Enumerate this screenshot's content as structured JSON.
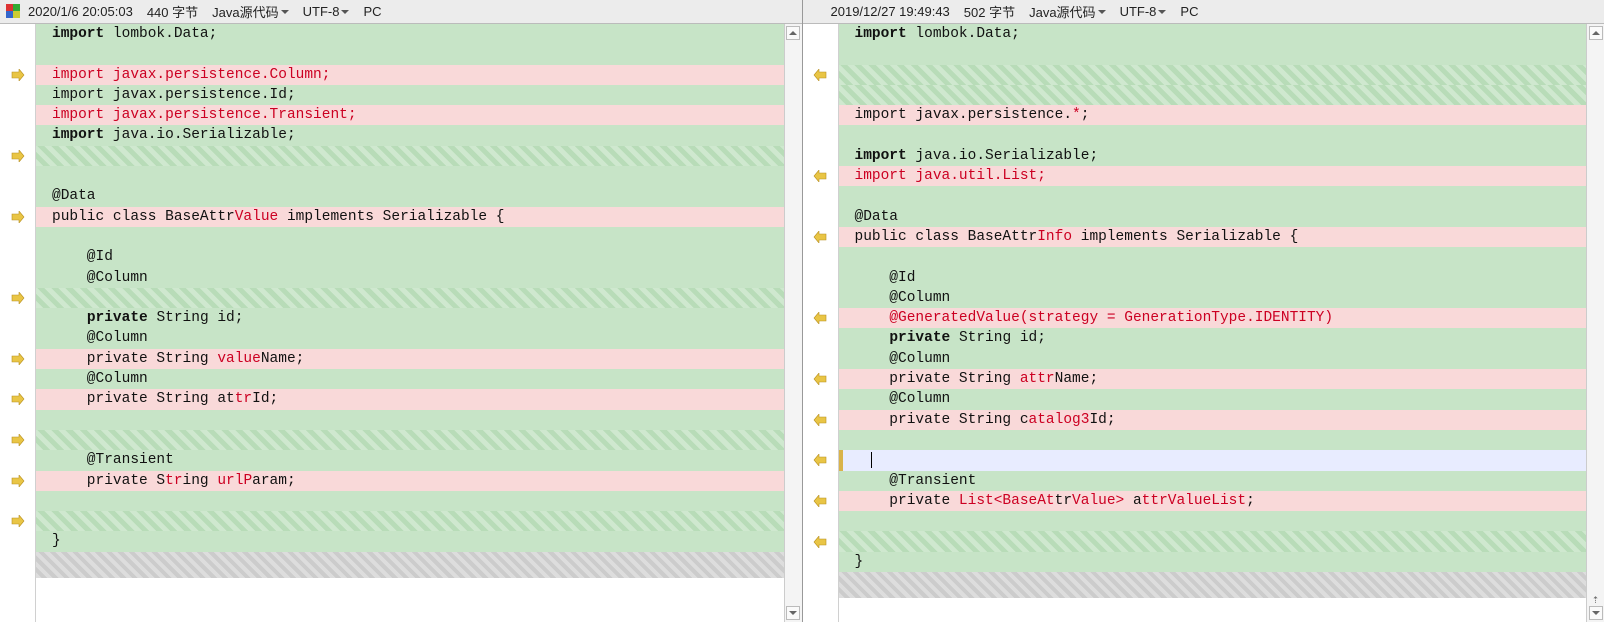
{
  "left": {
    "header": {
      "timestamp": "2020/1/6 20:05:03",
      "size": "440 字节",
      "type": "Java源代码",
      "encoding": "UTF-8",
      "lineend": "PC"
    },
    "lines": [
      {
        "bg": "same",
        "arrow": "",
        "spans": [
          {
            "t": "import ",
            "cls": "kw"
          },
          {
            "t": "lombok.Data;"
          }
        ]
      },
      {
        "bg": "same",
        "arrow": "",
        "spans": []
      },
      {
        "bg": "diff",
        "arrow": "r",
        "spans": [
          {
            "t": "import ",
            "cls": "rd"
          },
          {
            "t": "javax.persistence.Column;",
            "cls": "rd"
          }
        ]
      },
      {
        "bg": "same",
        "arrow": "",
        "spans": [
          {
            "t": "import javax.persistence.Id;"
          }
        ]
      },
      {
        "bg": "diff",
        "arrow": "",
        "spans": [
          {
            "t": "import ",
            "cls": "rd"
          },
          {
            "t": "javax.persistence.Transient;",
            "cls": "rd"
          }
        ]
      },
      {
        "bg": "same",
        "arrow": "",
        "spans": [
          {
            "t": "import ",
            "cls": "kw"
          },
          {
            "t": "java.io.Serializable;"
          }
        ]
      },
      {
        "bg": "hatch",
        "arrow": "r",
        "spans": []
      },
      {
        "bg": "same",
        "arrow": "",
        "spans": []
      },
      {
        "bg": "same",
        "arrow": "",
        "spans": [
          {
            "t": "@Data"
          }
        ]
      },
      {
        "bg": "diff",
        "arrow": "r",
        "spans": [
          {
            "t": "public class BaseAttr"
          },
          {
            "t": "Value",
            "cls": "rd"
          },
          {
            "t": " implements Serializable {"
          }
        ]
      },
      {
        "bg": "same",
        "arrow": "",
        "spans": []
      },
      {
        "bg": "same",
        "arrow": "",
        "spans": [
          {
            "t": "    @Id"
          }
        ]
      },
      {
        "bg": "same",
        "arrow": "",
        "spans": [
          {
            "t": "    @Column"
          }
        ]
      },
      {
        "bg": "hatch",
        "arrow": "r",
        "spans": []
      },
      {
        "bg": "same",
        "arrow": "",
        "spans": [
          {
            "t": "    ",
            "cls": ""
          },
          {
            "t": "private ",
            "cls": "kw"
          },
          {
            "t": "String id;"
          }
        ]
      },
      {
        "bg": "same",
        "arrow": "",
        "spans": [
          {
            "t": "    @Column"
          }
        ]
      },
      {
        "bg": "diff",
        "arrow": "r",
        "spans": [
          {
            "t": "    private String "
          },
          {
            "t": "value",
            "cls": "rd"
          },
          {
            "t": "Name;"
          }
        ]
      },
      {
        "bg": "same",
        "arrow": "",
        "spans": [
          {
            "t": "    @Column"
          }
        ]
      },
      {
        "bg": "diff",
        "arrow": "r",
        "spans": [
          {
            "t": "    private String at"
          },
          {
            "t": "tr",
            "cls": "rd"
          },
          {
            "t": "Id;"
          }
        ]
      },
      {
        "bg": "same",
        "arrow": "",
        "spans": []
      },
      {
        "bg": "hatch",
        "arrow": "r",
        "spans": []
      },
      {
        "bg": "same",
        "arrow": "",
        "spans": [
          {
            "t": "    @Transient"
          }
        ]
      },
      {
        "bg": "diff",
        "arrow": "r",
        "spans": [
          {
            "t": "    private S"
          },
          {
            "t": "tr",
            "cls": "rd"
          },
          {
            "t": "ing "
          },
          {
            "t": "urlP",
            "cls": "rd"
          },
          {
            "t": "aram;"
          }
        ]
      },
      {
        "bg": "same",
        "arrow": "",
        "spans": []
      },
      {
        "bg": "hatch",
        "arrow": "r",
        "spans": []
      },
      {
        "bg": "same",
        "arrow": "",
        "spans": [
          {
            "t": "}"
          }
        ]
      }
    ]
  },
  "right": {
    "header": {
      "timestamp": "2019/12/27 19:49:43",
      "size": "502 字节",
      "type": "Java源代码",
      "encoding": "UTF-8",
      "lineend": "PC"
    },
    "lines": [
      {
        "bg": "same",
        "arrow": "",
        "spans": [
          {
            "t": "import ",
            "cls": "kw"
          },
          {
            "t": "lombok.Data;"
          }
        ]
      },
      {
        "bg": "same",
        "arrow": "",
        "spans": []
      },
      {
        "bg": "hatch",
        "arrow": "l",
        "spans": []
      },
      {
        "bg": "hatch",
        "arrow": "",
        "spans": []
      },
      {
        "bg": "diff",
        "arrow": "",
        "spans": [
          {
            "t": "import javax.persistence."
          },
          {
            "t": "*",
            "cls": "rd"
          },
          {
            "t": ";"
          }
        ]
      },
      {
        "bg": "same",
        "arrow": "",
        "spans": []
      },
      {
        "bg": "same",
        "arrow": "",
        "spans": [
          {
            "t": "import ",
            "cls": "kw"
          },
          {
            "t": "java.io.Serializable;"
          }
        ]
      },
      {
        "bg": "diff",
        "arrow": "l",
        "spans": [
          {
            "t": "import ",
            "cls": "rd"
          },
          {
            "t": "java.util.List;",
            "cls": "rd"
          }
        ]
      },
      {
        "bg": "same",
        "arrow": "",
        "spans": []
      },
      {
        "bg": "same",
        "arrow": "",
        "spans": [
          {
            "t": "@Data"
          }
        ]
      },
      {
        "bg": "diff",
        "arrow": "l",
        "spans": [
          {
            "t": "public class BaseAttr"
          },
          {
            "t": "Info",
            "cls": "rd"
          },
          {
            "t": " implements Serializable {"
          }
        ]
      },
      {
        "bg": "same",
        "arrow": "",
        "spans": []
      },
      {
        "bg": "same",
        "arrow": "",
        "spans": [
          {
            "t": "    @Id"
          }
        ]
      },
      {
        "bg": "same",
        "arrow": "",
        "spans": [
          {
            "t": "    @Column"
          }
        ]
      },
      {
        "bg": "diff",
        "arrow": "l",
        "spans": [
          {
            "t": "    "
          },
          {
            "t": "@GeneratedValue(strategy = GenerationType.IDENTITY)",
            "cls": "rd"
          }
        ]
      },
      {
        "bg": "same",
        "arrow": "",
        "spans": [
          {
            "t": "    ",
            "cls": ""
          },
          {
            "t": "private ",
            "cls": "kw"
          },
          {
            "t": "String id;"
          }
        ]
      },
      {
        "bg": "same",
        "arrow": "",
        "spans": [
          {
            "t": "    @Column"
          }
        ]
      },
      {
        "bg": "diff",
        "arrow": "l",
        "spans": [
          {
            "t": "    private String "
          },
          {
            "t": "attr",
            "cls": "rd"
          },
          {
            "t": "Name;"
          }
        ]
      },
      {
        "bg": "same",
        "arrow": "",
        "spans": [
          {
            "t": "    @Column"
          }
        ]
      },
      {
        "bg": "diff",
        "arrow": "l",
        "spans": [
          {
            "t": "    private String c"
          },
          {
            "t": "atalog3",
            "cls": "rd"
          },
          {
            "t": "Id;"
          }
        ]
      },
      {
        "bg": "same",
        "arrow": "",
        "spans": []
      },
      {
        "bg": "cursor",
        "arrow": "l",
        "edit": true,
        "cursor": true,
        "spans": [
          {
            "t": " "
          }
        ]
      },
      {
        "bg": "same",
        "arrow": "",
        "spans": [
          {
            "t": "    @Transient"
          }
        ]
      },
      {
        "bg": "diff",
        "arrow": "l",
        "spans": [
          {
            "t": "    private "
          },
          {
            "t": "List<BaseAt",
            "cls": "rd"
          },
          {
            "t": "tr"
          },
          {
            "t": "Value> ",
            "cls": "rd"
          },
          {
            "t": "a"
          },
          {
            "t": "ttrValueList",
            "cls": "rd"
          },
          {
            "t": ";"
          }
        ]
      },
      {
        "bg": "same",
        "arrow": "",
        "spans": []
      },
      {
        "bg": "hatch",
        "arrow": "l",
        "spans": []
      },
      {
        "bg": "same",
        "arrow": "",
        "spans": [
          {
            "t": "}"
          }
        ]
      }
    ]
  }
}
